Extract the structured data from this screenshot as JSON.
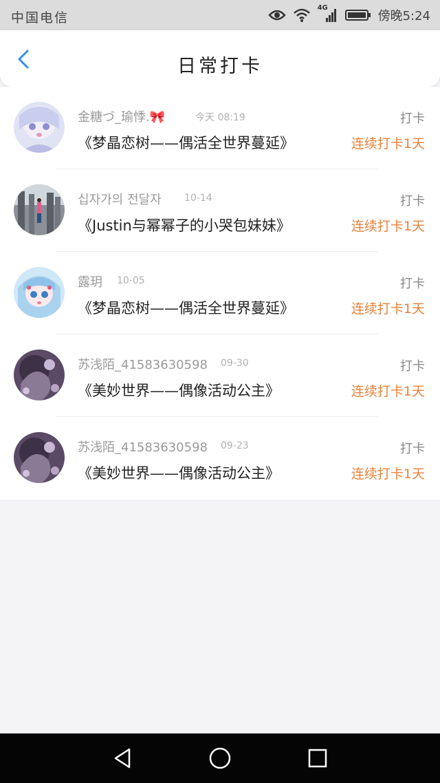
{
  "status_bar": {
    "carrier": "中国电信",
    "network": "4G",
    "time": "傍晚5:24"
  },
  "header": {
    "title": "日常打卡"
  },
  "entries": [
    {
      "name": "金糖づ_瑜悸.🎀",
      "date": "今天 08:19",
      "book": "《梦晶恋树——偶活全世界蔓延》",
      "action": "打卡",
      "streak": "连续打卡1天"
    },
    {
      "name": "십자가의 전달자",
      "date": "10-14",
      "book": "《Justin与幂幂子的小哭包妹妹》",
      "action": "打卡",
      "streak": "连续打卡1天"
    },
    {
      "name": "露玥",
      "date": "10-05",
      "book": "《梦晶恋树——偶活全世界蔓延》",
      "action": "打卡",
      "streak": "连续打卡1天"
    },
    {
      "name": "苏浅陌_415836305980…",
      "date": "09-30",
      "book": "《美妙世界——偶像活动公主》",
      "action": "打卡",
      "streak": "连续打卡1天"
    },
    {
      "name": "苏浅陌_415836305980…",
      "date": "09-23",
      "book": "《美妙世界——偶像活动公主》",
      "action": "打卡",
      "streak": "连续打卡1天"
    }
  ],
  "colors": {
    "accent_blue": "#2f8df5",
    "streak_orange": "#e8823a",
    "status_bar_bg": "#dcdcdc",
    "page_bg": "#f4f3f6",
    "nav_bar_bg": "#050505"
  },
  "icons": {
    "status": [
      "eye-icon",
      "wifi-icon",
      "signal-icon",
      "battery-icon"
    ],
    "nav": [
      "back-triangle-icon",
      "home-circle-icon",
      "recents-square-icon"
    ]
  }
}
